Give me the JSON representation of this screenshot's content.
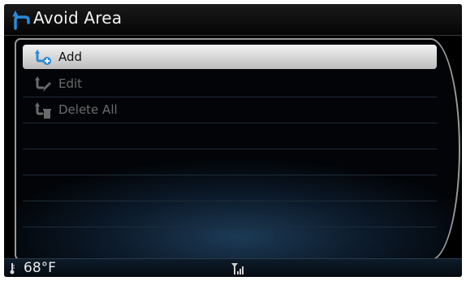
{
  "title": "Avoid Area",
  "menu": [
    {
      "label": "Add",
      "icon": "add-avoid-area-icon",
      "state": "selected"
    },
    {
      "label": "Edit",
      "icon": "edit-avoid-area-icon",
      "state": "disabled"
    },
    {
      "label": "Delete All",
      "icon": "delete-all-avoid-area-icon",
      "state": "disabled"
    }
  ],
  "status": {
    "temperature": "68°F",
    "signal_icon": "signal-strength-icon"
  },
  "colors": {
    "accent": "#2a8ad6",
    "selected_row": "#dcdcdc",
    "disabled_text": "#6c6c6c"
  }
}
